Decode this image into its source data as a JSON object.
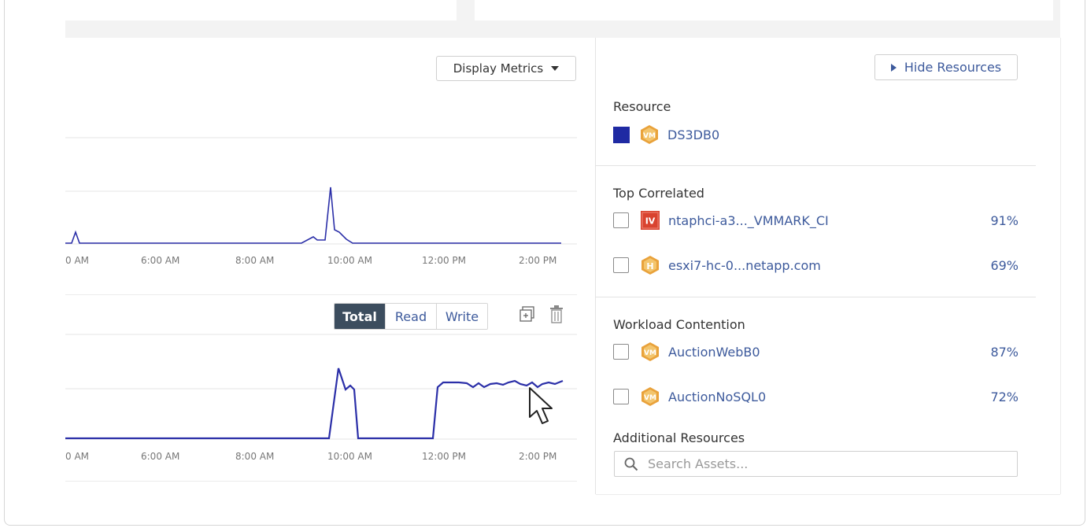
{
  "toolbar": {
    "display_metrics_label": "Display Metrics"
  },
  "charts": {
    "x_ticks": [
      "0 AM",
      "6:00 AM",
      "8:00 AM",
      "10:00 AM",
      "12:00 PM",
      "2:00 PM"
    ],
    "segment": {
      "total": "Total",
      "read": "Read",
      "write": "Write"
    }
  },
  "panel": {
    "hide_resources_label": "Hide Resources",
    "resource": {
      "title": "Resource",
      "name": "DS3DB0",
      "color": "#1f2aa3",
      "icon": "vm-icon"
    },
    "top_correlated": {
      "title": "Top Correlated",
      "items": [
        {
          "icon": "iv-icon",
          "badge": "IV",
          "name": "ntaphci-a3..._VMMARK_CI",
          "pct": "91%"
        },
        {
          "icon": "host-icon",
          "badge": "H",
          "name": "esxi7-hc-0...netapp.com",
          "pct": "69%"
        }
      ]
    },
    "workload_contention": {
      "title": "Workload Contention",
      "items": [
        {
          "icon": "vm-icon",
          "badge": "VM",
          "name": "AuctionWebB0",
          "pct": "87%"
        },
        {
          "icon": "vm-icon",
          "badge": "VM",
          "name": "AuctionNoSQL0",
          "pct": "72%"
        }
      ]
    },
    "additional_resources": {
      "title": "Additional Resources",
      "search_placeholder": "Search Assets..."
    }
  },
  "colors": {
    "series": "#2b2fa8",
    "accent": "#3d5a9c",
    "segment_active": "#3c4d5e",
    "icon_orange": "#e9a23b",
    "icon_red": "#d9432f"
  }
}
